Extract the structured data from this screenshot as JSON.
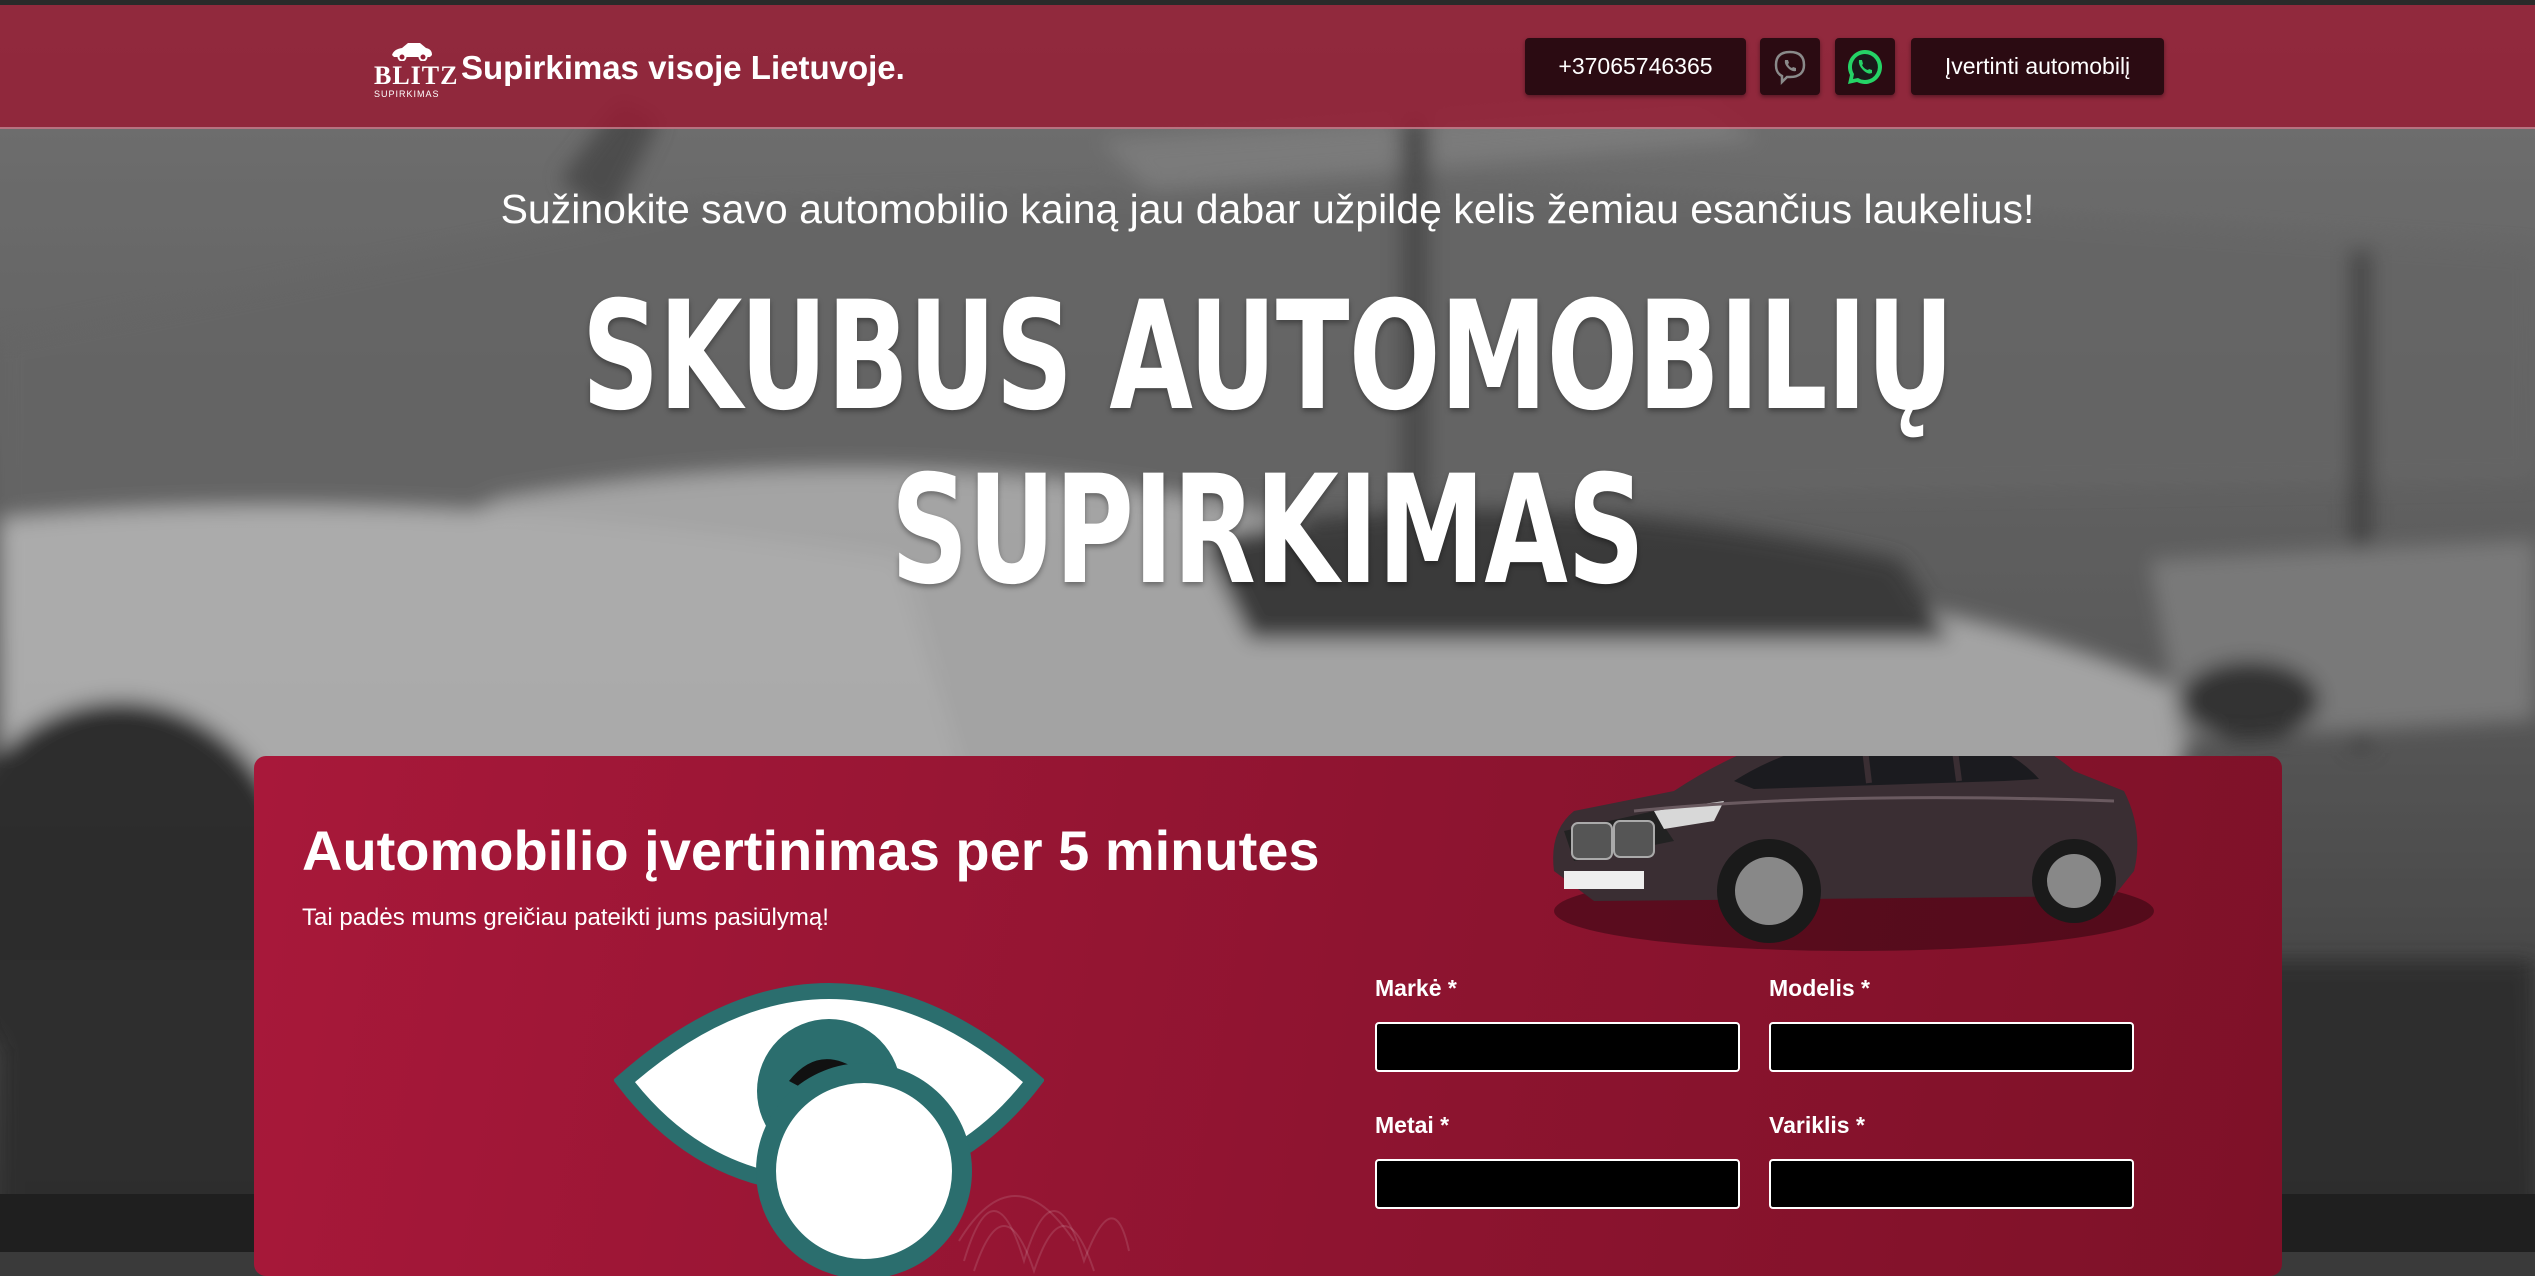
{
  "header": {
    "logo_brand": "BLITZ",
    "logo_sub": "SUPIRKIMAS",
    "tagline": "Supirkimas visoje Lietuvoje.",
    "phone": "+37065746365",
    "evaluate_button": "Įvertinti automobilį",
    "viber_icon": "viber-icon",
    "whatsapp_icon": "whatsapp-icon",
    "colors": {
      "header_bg": "#961c34",
      "button_bg": "#2b0b12",
      "whatsapp": "#25d366"
    }
  },
  "hero": {
    "subtitle": "Sužinokite savo automobilio kainą jau dabar užpildę kelis žemiau esančius laukelius!",
    "title": "SKUBUS AUTOMOBILIŲ SUPIRKIMAS"
  },
  "form": {
    "title": "Automobilio įvertinimas per 5 minutes",
    "subtitle": "Tai padės mums greičiau pateikti jums pasiūlymą!",
    "fields": [
      {
        "label": "Markė *",
        "value": ""
      },
      {
        "label": "Modelis *",
        "value": ""
      },
      {
        "label": "Metai *",
        "value": ""
      },
      {
        "label": "Variklis *",
        "value": ""
      }
    ],
    "colors": {
      "card": "#9c1634",
      "eye_outline": "#2b6e6e"
    }
  }
}
